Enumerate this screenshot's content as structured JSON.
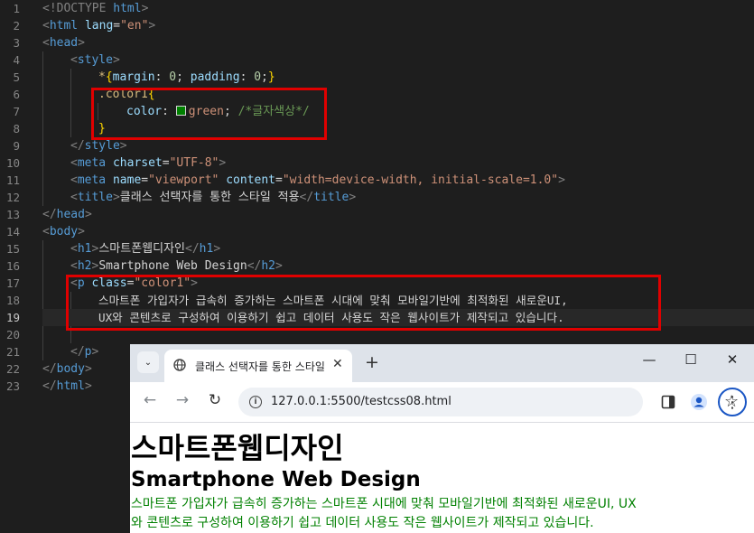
{
  "editor": {
    "line_numbers": [
      "1",
      "2",
      "3",
      "4",
      "5",
      "6",
      "7",
      "8",
      "9",
      "10",
      "11",
      "12",
      "13",
      "14",
      "15",
      "16",
      "17",
      "18",
      "19",
      "20",
      "21",
      "22",
      "23"
    ],
    "code": {
      "l1": {
        "a": "<!DOCTYPE ",
        "b": "html",
        "c": ">"
      },
      "l2": {
        "a": "<",
        "b": "html",
        "c": " lang",
        "d": "=",
        "e": "\"en\"",
        "f": ">"
      },
      "l3": {
        "a": "<",
        "b": "head",
        "c": ">"
      },
      "l4": {
        "a": "<",
        "b": "style",
        "c": ">"
      },
      "l5": {
        "a": "*",
        "b": "{",
        "c": "margin",
        "d": ": ",
        "e": "0",
        "f": "; ",
        "g": "padding",
        "h": ": ",
        "i": "0",
        "j": ";",
        "k": "}"
      },
      "l6": {
        "a": ".color1",
        "b": "{"
      },
      "l7": {
        "a": "color",
        "b": ": ",
        "c": "green",
        "d": "; ",
        "e": "/*글자색상*/"
      },
      "l8": {
        "a": "}"
      },
      "l9": {
        "a": "</",
        "b": "style",
        "c": ">"
      },
      "l10": {
        "a": "<",
        "b": "meta",
        "c": " charset",
        "d": "=",
        "e": "\"UTF-8\"",
        "f": ">"
      },
      "l11": {
        "a": "<",
        "b": "meta",
        "c": " name",
        "d": "=",
        "e": "\"viewport\"",
        "f": " content",
        "g": "=",
        "h": "\"width=device-width, initial-scale=1.0\"",
        "i": ">"
      },
      "l12": {
        "a": "<",
        "b": "title",
        "c": ">",
        "d": "클래스 선택자를 통한 스타일 적용",
        "e": "</",
        "f": "title",
        "g": ">"
      },
      "l13": {
        "a": "</",
        "b": "head",
        "c": ">"
      },
      "l14": {
        "a": "<",
        "b": "body",
        "c": ">"
      },
      "l15": {
        "a": "<",
        "b": "h1",
        "c": ">",
        "d": "스마트폰웹디자인",
        "e": "</",
        "f": "h1",
        "g": ">"
      },
      "l16": {
        "a": "<",
        "b": "h2",
        "c": ">",
        "d": "Smartphone Web Design",
        "e": "</",
        "f": "h2",
        "g": ">"
      },
      "l17": {
        "a": "<",
        "b": "p",
        "c": " class",
        "d": "=",
        "e": "\"color1\"",
        "f": ">"
      },
      "l18": {
        "a": "스마트폰 가입자가 급속히 증가하는 스마트폰 시대에 맞춰 모바일기반에 최적화된 새로운UI,"
      },
      "l19": {
        "a": "UX와 콘텐츠로 구성하여 이용하기 쉽고 데이터 사용도 작은 웹사이트가 제작되고 있습니다."
      },
      "l21": {
        "a": "</",
        "b": "p",
        "c": ">"
      },
      "l22": {
        "a": "</",
        "b": "body",
        "c": ">"
      },
      "l23": {
        "a": "</",
        "b": "html",
        "c": ">"
      }
    },
    "swatch_color": "#008000",
    "highlight_color": "#e00000"
  },
  "browser": {
    "tab_title": "클래스 선택자를 통한 스타일 적용",
    "tab_close": "✕",
    "new_tab": "+",
    "tab_search": "⌄",
    "minimize": "—",
    "maximize": "☐",
    "close": "✕",
    "back": "←",
    "forward": "→",
    "reload": "↻",
    "url": "127.0.0.1:5500/testcss08.html",
    "star": "☆",
    "menu": "⋮",
    "page": {
      "h1": "스마트폰웹디자인",
      "h2": "Smartphone Web Design",
      "p_line1": "스마트폰 가입자가 급속히 증가하는 스마트폰 시대에 맞춰 모바일기반에 최적화된 새로운UI, UX",
      "p_line2": "와 콘텐츠로 구성하여 이용하기 쉽고 데이터 사용도 작은 웹사이트가 제작되고 있습니다.",
      "text_color": "#008000"
    }
  }
}
